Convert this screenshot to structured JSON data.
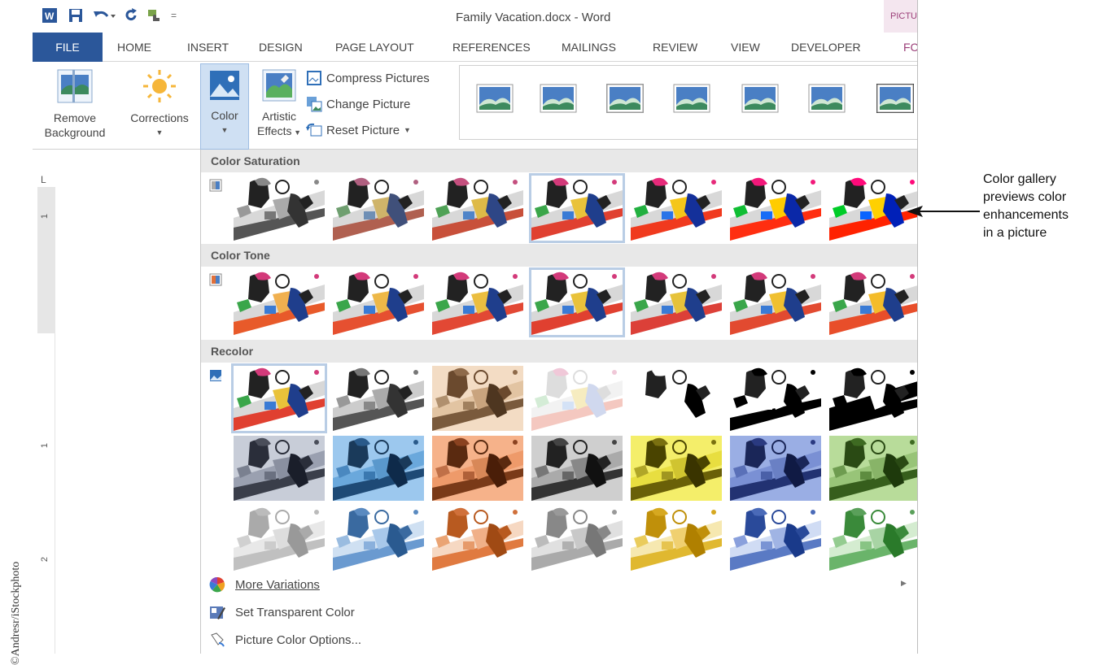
{
  "window": {
    "title": "Family Vacation.docx - Word",
    "context_tab": "PICTU"
  },
  "tabs": [
    {
      "label": "FILE"
    },
    {
      "label": "HOME"
    },
    {
      "label": "INSERT"
    },
    {
      "label": "DESIGN"
    },
    {
      "label": "PAGE LAYOUT"
    },
    {
      "label": "REFERENCES"
    },
    {
      "label": "MAILINGS"
    },
    {
      "label": "REVIEW"
    },
    {
      "label": "VIEW"
    },
    {
      "label": "DEVELOPER"
    },
    {
      "label": "FC"
    }
  ],
  "ribbon": {
    "remove_background": {
      "line1": "Remove",
      "line2": "Background"
    },
    "corrections": {
      "label": "Corrections"
    },
    "color": {
      "label": "Color"
    },
    "artistic_effects": {
      "line1": "Artistic",
      "line2": "Effects"
    },
    "compress_pictures": "Compress Pictures",
    "change_picture": "Change Picture",
    "reset_picture": "Reset Picture"
  },
  "ruler": {
    "corner": "L",
    "numbers": [
      "1",
      "1",
      "2"
    ]
  },
  "color_panel": {
    "sections": {
      "saturation": "Color Saturation",
      "tone": "Color Tone",
      "recolor": "Recolor"
    },
    "menu": {
      "more_variations": "More Variations",
      "set_transparent": "Set Transparent Color",
      "picture_color_options": "Picture Color Options..."
    }
  },
  "annotation": {
    "line1": "Color gallery",
    "line2": "previews color",
    "line3": "enhancements",
    "line4": "in a picture"
  },
  "credit": "©Andresr/iStockphoto",
  "colors": {
    "file_tab": "#2b579a",
    "context_tab_bg": "#f4e6ef",
    "context_tab_text": "#9b3e78",
    "selected_outline": "#b9cde5",
    "section_header": "#e8e8e8"
  }
}
